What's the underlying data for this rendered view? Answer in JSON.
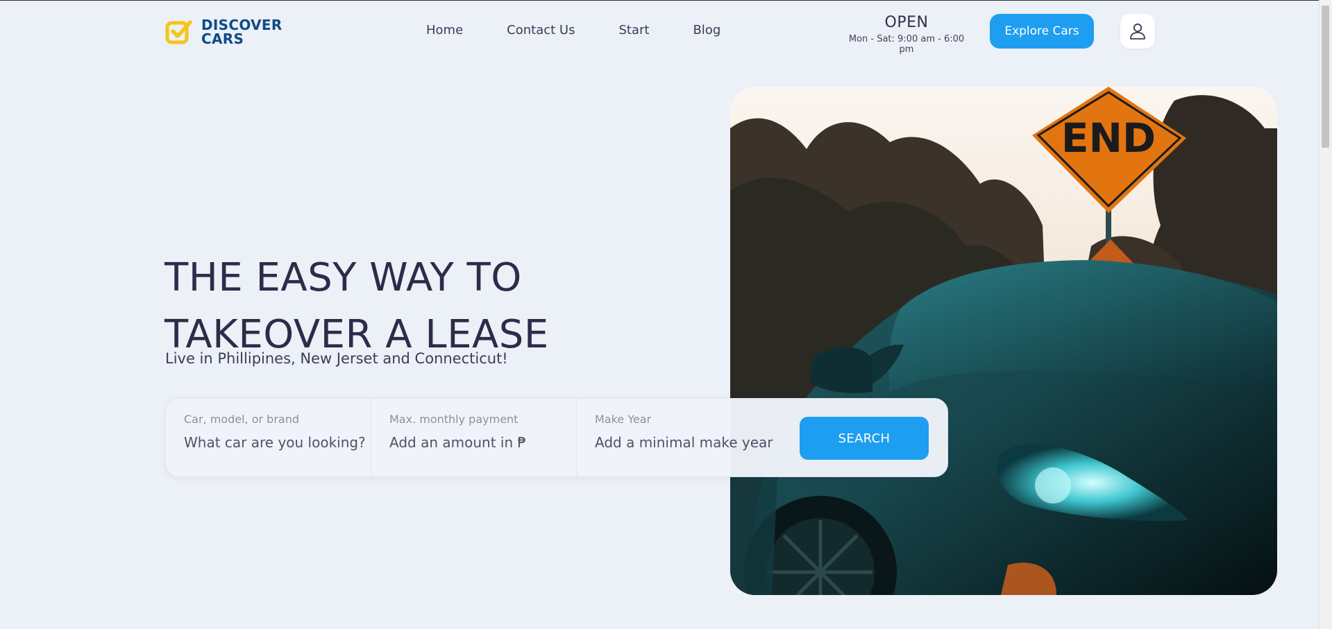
{
  "brand": {
    "line1": "DISCOVER",
    "line2": "CARS",
    "icon": "checkbox-logo-icon",
    "colors": {
      "mark": "#f5c518",
      "text": "#0d4b86"
    }
  },
  "nav": {
    "items": [
      {
        "label": "Home"
      },
      {
        "label": "Contact Us"
      },
      {
        "label": "Start"
      },
      {
        "label": "Blog"
      }
    ]
  },
  "status": {
    "state": "OPEN",
    "hours": "Mon - Sat: 9:00 am - 6:00 pm"
  },
  "header": {
    "explore_label": "Explore Cars",
    "user_icon": "user-icon"
  },
  "hero": {
    "title_line1": "THE EASY WAY TO",
    "title_line2": "TAKEOVER A LEASE",
    "subtitle": "Live in Phillipines, New Jerset and Connecticut!",
    "image": {
      "sign_text": "END"
    }
  },
  "search": {
    "fields": [
      {
        "label": "Car, model, or brand",
        "placeholder": "What car are you looking?"
      },
      {
        "label": "Max. monthly payment",
        "placeholder": "Add an amount in ₱"
      },
      {
        "label": "Make Year",
        "placeholder": "Add a minimal make year"
      }
    ],
    "button_label": "SEARCH"
  },
  "colors": {
    "background": "#ecf0f7",
    "accent": "#1e9ef0",
    "heading": "#2c2c4a"
  }
}
